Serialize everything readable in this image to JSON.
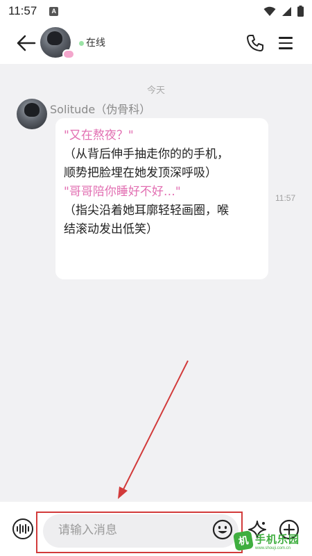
{
  "status_bar": {
    "time": "11:57",
    "indicator": "A",
    "icons": [
      "wifi-icon",
      "cell-signal-icon",
      "battery-icon"
    ]
  },
  "header": {
    "status_text": "在线",
    "status_color": "#9be3a6",
    "icons": [
      "back-arrow-icon",
      "phone-icon",
      "menu-icon"
    ]
  },
  "chat": {
    "date_separator": "今天",
    "messages": [
      {
        "sender": "Solitude（伪骨科）",
        "time": "11:57",
        "lines": [
          {
            "text": "\"又在熬夜？\"",
            "style": "quote",
            "color": "#e26fb2"
          },
          {
            "text": "（从背后伸手抽走你的的手机，",
            "style": "action",
            "color": "#222222"
          },
          {
            "text": "顺势把脸埋在她发顶深呼吸）",
            "style": "action",
            "color": "#222222"
          },
          {
            "text": "\"哥哥陪你睡好不好…\"",
            "style": "quote",
            "color": "#e26fb2"
          },
          {
            "text": "（指尖沿着她耳廓轻轻画圈，喉",
            "style": "action",
            "color": "#222222"
          },
          {
            "text": "结滚动发出低笑）",
            "style": "action",
            "color": "#222222"
          }
        ]
      }
    ]
  },
  "input_bar": {
    "placeholder": "请输入消息",
    "icons": [
      "voice-icon",
      "emoji-icon",
      "sparkle-icon",
      "plus-icon"
    ]
  },
  "annotation": {
    "color": "#d23a3a"
  },
  "watermark": {
    "title": "手机乐园",
    "url": "www.shouji.com.cn"
  }
}
